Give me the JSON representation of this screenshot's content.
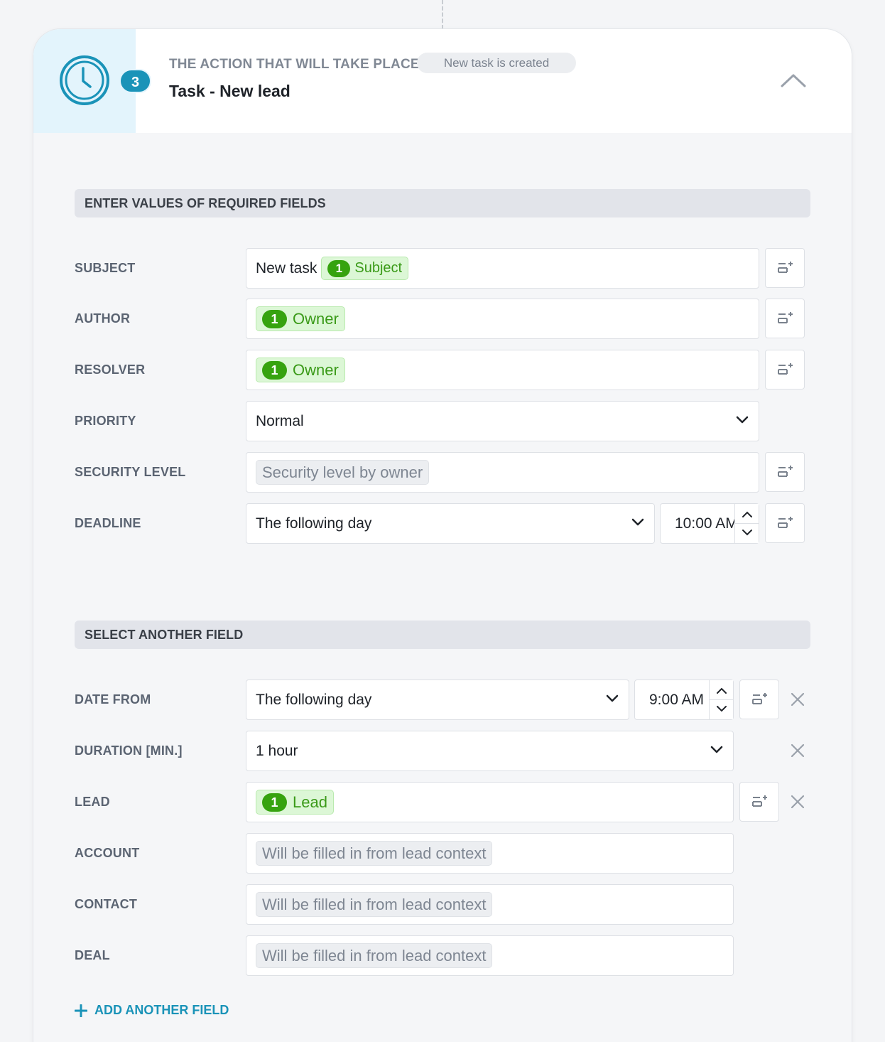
{
  "header": {
    "step_number": "3",
    "label": "THE ACTION THAT WILL TAKE PLACE",
    "trigger": "New task is created",
    "title": "Task - New lead",
    "icon": "clock-icon"
  },
  "required_section": {
    "title": "ENTER VALUES OF REQUIRED FIELDS",
    "fields": {
      "subject": {
        "label": "SUBJECT",
        "text": "New task",
        "chip_num": "1",
        "chip_label": "Subject"
      },
      "author": {
        "label": "AUTHOR",
        "chip_num": "1",
        "chip_label": "Owner"
      },
      "resolver": {
        "label": "RESOLVER",
        "chip_num": "1",
        "chip_label": "Owner"
      },
      "priority": {
        "label": "PRIORITY",
        "value": "Normal"
      },
      "security": {
        "label": "SECURITY LEVEL",
        "chip_label": "Security level by owner"
      },
      "deadline": {
        "label": "DEADLINE",
        "value": "The following day",
        "time": "10:00 AM"
      }
    }
  },
  "other_section": {
    "title": "SELECT ANOTHER FIELD",
    "fields": {
      "date_from": {
        "label": "DATE FROM",
        "value": "The following day",
        "time": "9:00 AM"
      },
      "duration": {
        "label": "DURATION [MIN.]",
        "value": "1 hour"
      },
      "lead": {
        "label": "LEAD",
        "chip_num": "1",
        "chip_label": "Lead"
      },
      "account": {
        "label": "ACCOUNT",
        "chip_label": "Will be filled in from lead context"
      },
      "contact": {
        "label": "CONTACT",
        "chip_label": "Will be filled in from lead context"
      },
      "deal": {
        "label": "DEAL",
        "chip_label": "Will be filled in from lead context"
      }
    },
    "add_label": "ADD ANOTHER FIELD"
  },
  "colors": {
    "accent": "#1a93b8",
    "chip_green_bg": "#dcf7d6",
    "chip_green_text": "#3a9a18",
    "icon_panel_bg": "#e3f4fc"
  }
}
